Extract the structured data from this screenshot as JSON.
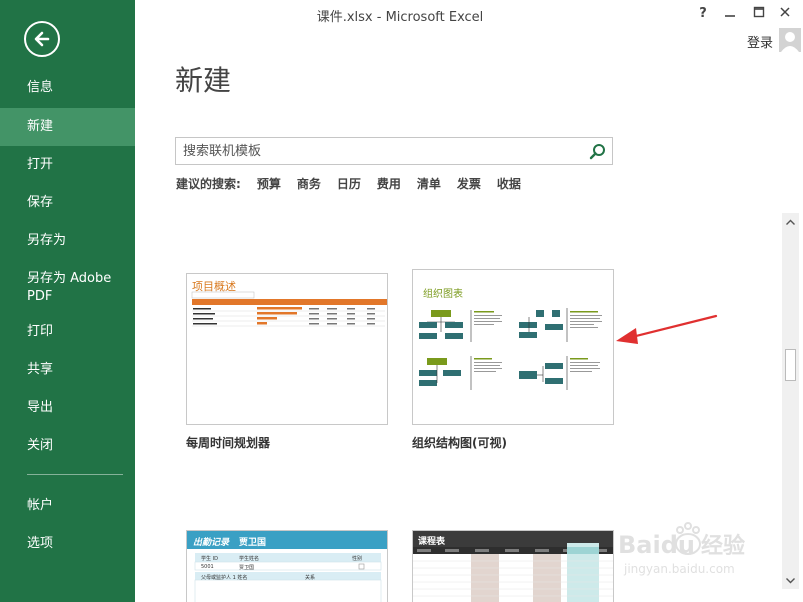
{
  "window": {
    "title": "课件.xlsx - Microsoft Excel",
    "help": "?",
    "login": "登录"
  },
  "sidebar": {
    "items": [
      {
        "label": "信息"
      },
      {
        "label": "新建"
      },
      {
        "label": "打开"
      },
      {
        "label": "保存"
      },
      {
        "label": "另存为"
      },
      {
        "label": "另存为 Adobe PDF"
      },
      {
        "label": "打印"
      },
      {
        "label": "共享"
      },
      {
        "label": "导出"
      },
      {
        "label": "关闭"
      },
      {
        "label": "帐户"
      },
      {
        "label": "选项"
      }
    ]
  },
  "main": {
    "page_title": "新建",
    "search": {
      "placeholder": "搜索联机模板"
    },
    "suggested_label": "建议的搜索:",
    "suggested": [
      "预算",
      "商务",
      "日历",
      "费用",
      "清单",
      "发票",
      "收据"
    ]
  },
  "templates": [
    {
      "caption": "每周时间规划器",
      "thumb_title": "项目概述"
    },
    {
      "caption": "组织结构图(可视)",
      "thumb_title": "组织图表"
    },
    {
      "thumb_title": "出勤记录",
      "thumb_name": "贾卫国",
      "col1": "学生 ID",
      "col2": "学生姓名",
      "col3": "性别",
      "row_id": "5001",
      "row_name": "贾卫国",
      "row2": "父母或监护人 1 姓名",
      "row2b": "关系"
    },
    {
      "thumb_title": "课程表"
    }
  ],
  "watermark": {
    "brand": "Baidu",
    "text_cn": "经验",
    "url": "jingyan.baidu.com"
  },
  "colors": {
    "sidebar": "#217346",
    "sidebar_active": "#439467",
    "accent_orange": "#e2772a",
    "org_teal": "#2f6f72",
    "org_green": "#7a9a1c",
    "arrow_red": "#e03030"
  }
}
